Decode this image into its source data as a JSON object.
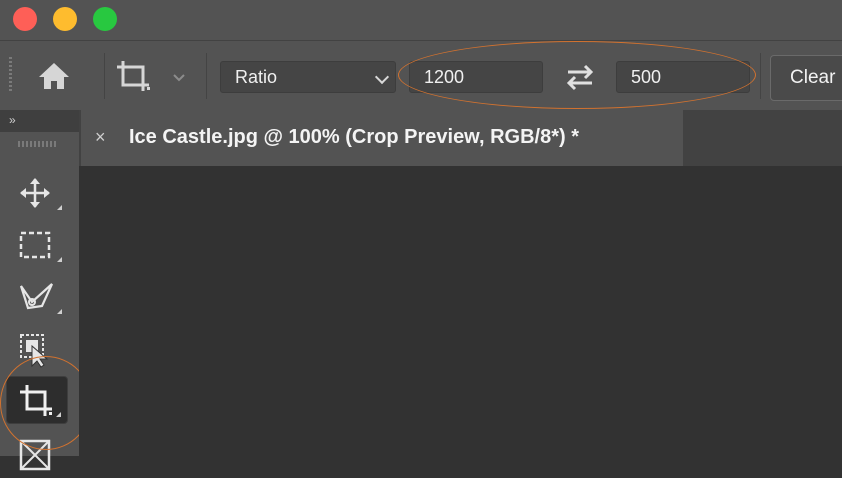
{
  "window": {
    "traffic_lights": [
      "close",
      "minimize",
      "maximize"
    ],
    "colors": {
      "close": "#fe5f57",
      "minimize": "#febc2e",
      "maximize": "#28c840"
    }
  },
  "options_bar": {
    "home_icon": "home-icon",
    "crop_tool_icon": "crop-icon",
    "ratio_select": {
      "value": "Ratio"
    },
    "width_input": {
      "value": "1200"
    },
    "swap_icon": "swap-arrows-icon",
    "height_input": {
      "value": "500"
    },
    "clear_label": "Clear"
  },
  "toolbar": {
    "collapse_label": "»",
    "tools": [
      {
        "name": "move-tool",
        "icon": "move-icon"
      },
      {
        "name": "marquee-tool",
        "icon": "rectangular-marquee-icon"
      },
      {
        "name": "lasso-tool",
        "icon": "polygonal-lasso-icon"
      },
      {
        "name": "object-selection-tool",
        "icon": "object-selection-icon"
      },
      {
        "name": "crop-tool",
        "icon": "crop-icon",
        "active": true
      },
      {
        "name": "frame-tool",
        "icon": "frame-icon"
      }
    ]
  },
  "document": {
    "tab_title": "Ice Castle.jpg @ 100% (Crop Preview, RGB/8*) *",
    "close_glyph": "×"
  },
  "annotations": {
    "ellipse_color": "#d2722f"
  }
}
